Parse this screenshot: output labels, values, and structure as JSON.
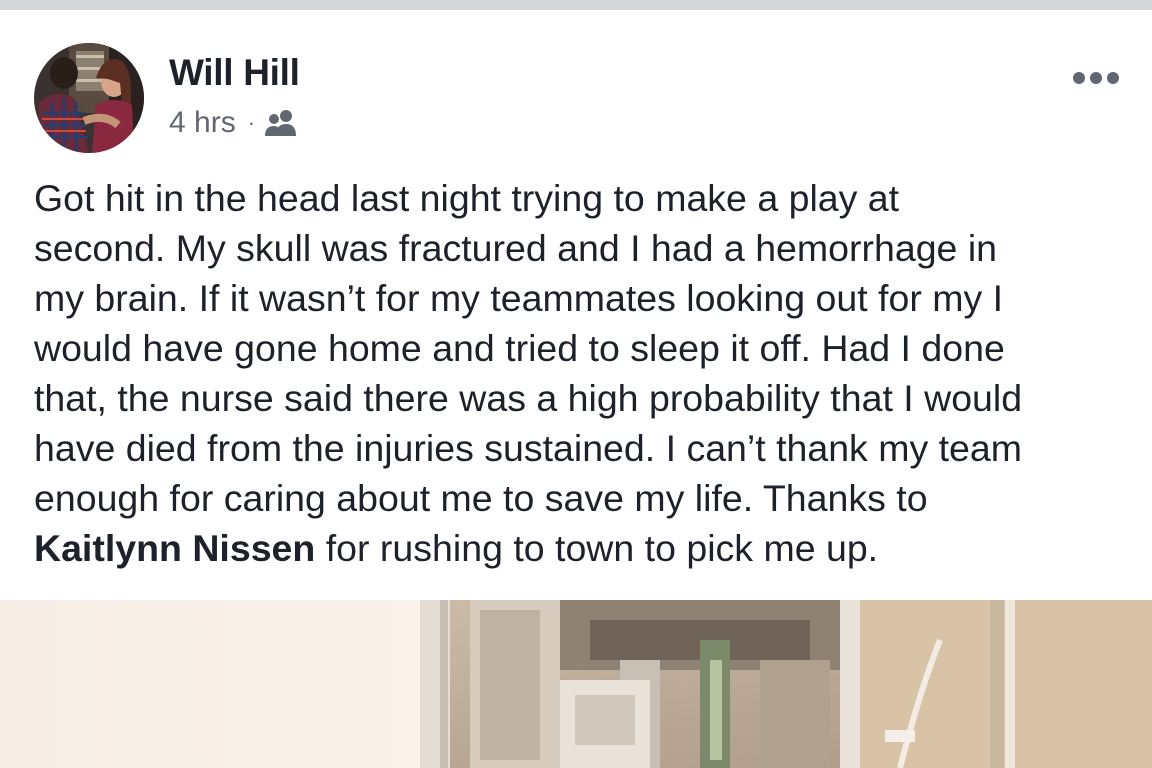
{
  "post": {
    "author": "Will Hill",
    "timestamp": "4 hrs",
    "separator": "·",
    "audience_icon": "friends-icon",
    "more_icon": "more-options-icon",
    "body_lines": [
      "Got hit in the head last night trying to make a play at",
      "second.  My skull was fractured and I had a hemorrhage in",
      "my brain.  If it wasn’t for my teammates looking out for my I",
      "would have gone home and tried to sleep it off.  Had I done",
      "that, the nurse said there was a high probability that I would",
      "have died from the injuries sustained.  I can’t thank my team",
      "enough for caring about me to save my life.  Thanks to"
    ],
    "mention": "Kaitlynn Nissen",
    "last_line_rest": " for rushing to town to pick me up."
  },
  "colors": {
    "text": "#1d2129",
    "meta": "#616770",
    "icon_gray": "#8d949e",
    "top_bar": "#d3d6db"
  }
}
